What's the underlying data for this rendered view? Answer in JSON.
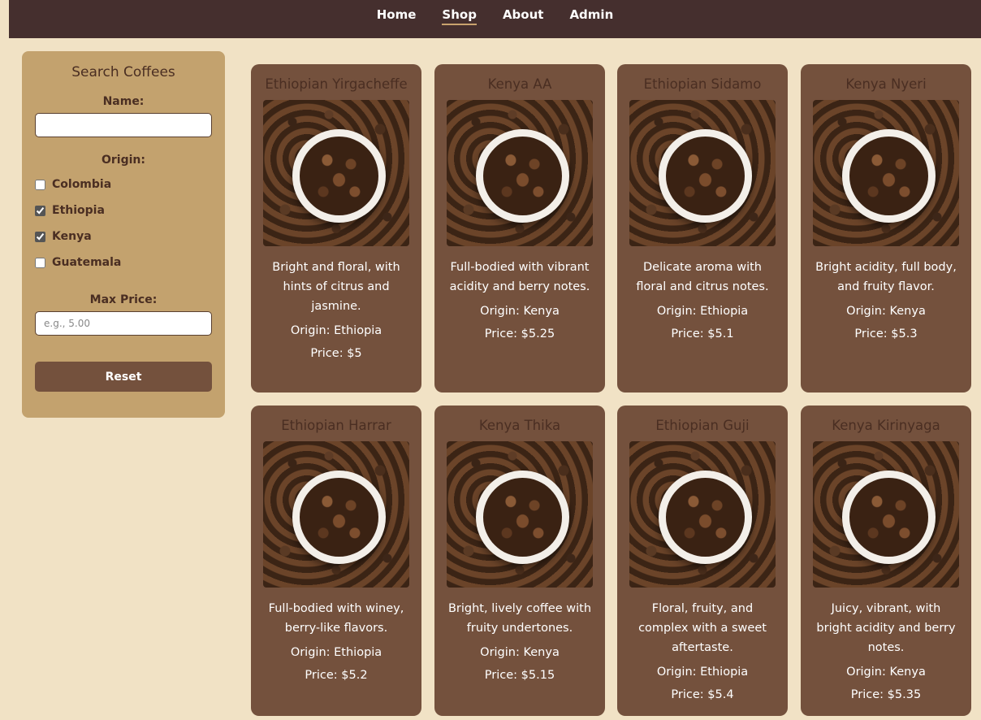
{
  "nav": {
    "items": [
      {
        "label": "Home"
      },
      {
        "label": "Shop"
      },
      {
        "label": "About"
      },
      {
        "label": "Admin"
      }
    ],
    "active": "Shop"
  },
  "sidebar": {
    "title": "Search Coffees",
    "name_label": "Name:",
    "name_value": "",
    "origin_label": "Origin:",
    "origins": [
      {
        "label": "Colombia",
        "checked": false
      },
      {
        "label": "Ethiopia",
        "checked": true
      },
      {
        "label": "Kenya",
        "checked": true
      },
      {
        "label": "Guatemala",
        "checked": false
      }
    ],
    "max_price_label": "Max Price:",
    "max_price_placeholder": "e.g., 5.00",
    "reset_label": "Reset"
  },
  "products": [
    {
      "name": "Ethiopian Yirgacheffe",
      "description": "Bright and floral, with hints of citrus and jasmine.",
      "origin": "Origin: Ethiopia",
      "price": "Price: $5"
    },
    {
      "name": "Kenya AA",
      "description": "Full-bodied with vibrant acidity and berry notes.",
      "origin": "Origin: Kenya",
      "price": "Price: $5.25"
    },
    {
      "name": "Ethiopian Sidamo",
      "description": "Delicate aroma with floral and citrus notes.",
      "origin": "Origin: Ethiopia",
      "price": "Price: $5.1"
    },
    {
      "name": "Kenya Nyeri",
      "description": "Bright acidity, full body, and fruity flavor.",
      "origin": "Origin: Kenya",
      "price": "Price: $5.3"
    },
    {
      "name": "Ethiopian Harrar",
      "description": "Full-bodied with winey, berry-like flavors.",
      "origin": "Origin: Ethiopia",
      "price": "Price: $5.2"
    },
    {
      "name": "Kenya Thika",
      "description": "Bright, lively coffee with fruity undertones.",
      "origin": "Origin: Kenya",
      "price": "Price: $5.15"
    },
    {
      "name": "Ethiopian Guji",
      "description": "Floral, fruity, and complex with a sweet aftertaste.",
      "origin": "Origin: Ethiopia",
      "price": "Price: $5.4"
    },
    {
      "name": "Kenya Kirinyaga",
      "description": "Juicy, vibrant, with bright acidity and berry notes.",
      "origin": "Origin: Kenya",
      "price": "Price: $5.35"
    }
  ]
}
